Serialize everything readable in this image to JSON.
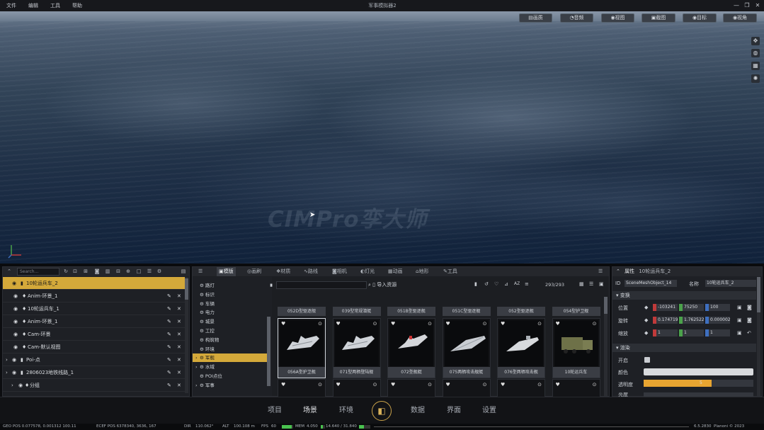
{
  "menubar": {
    "items": [
      "文件",
      "编辑",
      "工具",
      "帮助"
    ],
    "title": "军事模拟器2"
  },
  "viewport": {
    "buttons": [
      {
        "icon": "page-icon",
        "label": "画质"
      },
      {
        "icon": "sound-icon",
        "label": "音频"
      },
      {
        "icon": "eye-icon",
        "label": "视图"
      },
      {
        "icon": "camera-icon",
        "label": "截图"
      },
      {
        "icon": "eye-icon",
        "label": "目标"
      },
      {
        "icon": "eye-icon",
        "label": "视角"
      }
    ],
    "side_icons": [
      "move-icon",
      "globe-icon",
      "grid-icon",
      "compass-icon"
    ],
    "watermark": "CIMPro孪大师"
  },
  "outliner": {
    "search_placeholder": "Search...",
    "toolbar_icons": [
      "refresh-icon",
      "frame-icon",
      "frame-icon",
      "camera-icon",
      "film-icon",
      "link-icon",
      "lock-icon",
      "box-icon",
      "list-icon",
      "gear-icon",
      "panel-icon"
    ],
    "rows": [
      {
        "label": "10轮运兵车_2",
        "selected": true,
        "indent": 0
      },
      {
        "label": "Anim-环景_1",
        "selected": false,
        "indent": 1
      },
      {
        "label": "10轮运兵车_1",
        "selected": false,
        "indent": 1
      },
      {
        "label": "Anim-环景_1",
        "selected": false,
        "indent": 1
      },
      {
        "label": "Cam-环景",
        "selected": false,
        "indent": 1
      },
      {
        "label": "Cam-默认视图",
        "selected": false,
        "indent": 1
      },
      {
        "label": "Poi-点",
        "selected": false,
        "indent": 0
      },
      {
        "label": "2806023地铁线路_1",
        "selected": false,
        "indent": 0
      },
      {
        "label": "分组",
        "selected": false,
        "indent": 1
      }
    ]
  },
  "assets": {
    "tabs": [
      {
        "label": "模版",
        "active": true
      },
      {
        "label": "画刷"
      },
      {
        "label": "材质"
      },
      {
        "label": "路线"
      },
      {
        "label": "相机"
      },
      {
        "label": "灯光"
      },
      {
        "label": "动画"
      },
      {
        "label": "地形"
      },
      {
        "label": "工具"
      }
    ],
    "tree": [
      {
        "label": "路灯",
        "selected": false,
        "expand": ""
      },
      {
        "label": "标识",
        "selected": false,
        "expand": ""
      },
      {
        "label": "车辆",
        "selected": false,
        "expand": ""
      },
      {
        "label": "电力",
        "selected": false,
        "expand": ""
      },
      {
        "label": "城景",
        "selected": false,
        "expand": ""
      },
      {
        "label": "工控",
        "selected": false,
        "expand": ""
      },
      {
        "label": "构筑物",
        "selected": false,
        "expand": ""
      },
      {
        "label": "环境",
        "selected": false,
        "expand": ""
      },
      {
        "label": "军舰",
        "selected": true,
        "expand": "›"
      },
      {
        "label": "水域",
        "selected": false,
        "expand": "›"
      },
      {
        "label": "POI点位",
        "selected": false,
        "expand": ""
      },
      {
        "label": "军事",
        "selected": false,
        "expand": "›"
      }
    ],
    "import_label": "导入资源",
    "count": "293/293",
    "top_labels": [
      "052D型驱逐舰",
      "039型常规潜艇",
      "051B型驱逐舰",
      "051C型驱逐舰",
      "052型驱逐舰",
      "054型护卫舰"
    ],
    "cards": [
      {
        "label": "056A型护卫舰",
        "selected": true,
        "kind": "ship"
      },
      {
        "label": "071型两栖登陆舰",
        "selected": false,
        "kind": "ship"
      },
      {
        "label": "072型舰艇",
        "selected": false,
        "kind": "ship2"
      },
      {
        "label": "075两栖攻击舰艇",
        "selected": false,
        "kind": "carrier"
      },
      {
        "label": "076型两栖攻击舰",
        "selected": false,
        "kind": "carrier2"
      },
      {
        "label": "10轮运兵车",
        "selected": false,
        "kind": "truck"
      }
    ]
  },
  "properties": {
    "title": "属性",
    "object": "10轮运兵车_2",
    "id_label": "ID",
    "id_value": "SceneMeshObject_14",
    "name_label": "名称",
    "name_value": "10轮运兵车_2",
    "sections": {
      "transform": "变换",
      "render": "渲染"
    },
    "transform_rows": [
      {
        "label": "位置",
        "x": "-103241",
        "y": "75250",
        "z": "100"
      },
      {
        "label": "旋转",
        "x": "0.174719",
        "y": "1.762522",
        "z": "0.000002"
      },
      {
        "label": "缩放",
        "x": "1",
        "y": "1",
        "z": "1"
      }
    ],
    "render_rows": [
      {
        "label": "开启"
      },
      {
        "label": "颜色"
      },
      {
        "label": "透明度",
        "value": "5"
      },
      {
        "label": "亮度"
      }
    ],
    "opacity_fill": 0.62,
    "accent": "#e8a531"
  },
  "bottomnav": {
    "items": [
      {
        "label": "项目"
      },
      {
        "label": "场景",
        "active": true
      },
      {
        "label": "环境"
      },
      {
        "label": "数据"
      },
      {
        "label": "界面"
      },
      {
        "label": "设置"
      }
    ]
  },
  "status": {
    "geo": "GEO POS 0.077578, 0.001312 100.11",
    "ecef": "ECEF POS 6378340, 3636, 167",
    "dir_label": "DIR",
    "dir": "110.062°",
    "alt_label": "ALT",
    "alt": "100.108 m",
    "fps_label": "FPS",
    "fps": "60",
    "mem_label": "MEM",
    "mem": "4.050",
    "vram": "14.640 / 31.840",
    "fps_fill": 0.9,
    "mem_fill": 0.5,
    "vram_fill": 0.46,
    "version": "6.5.2830",
    "copyright": "Planoni © 2023"
  }
}
